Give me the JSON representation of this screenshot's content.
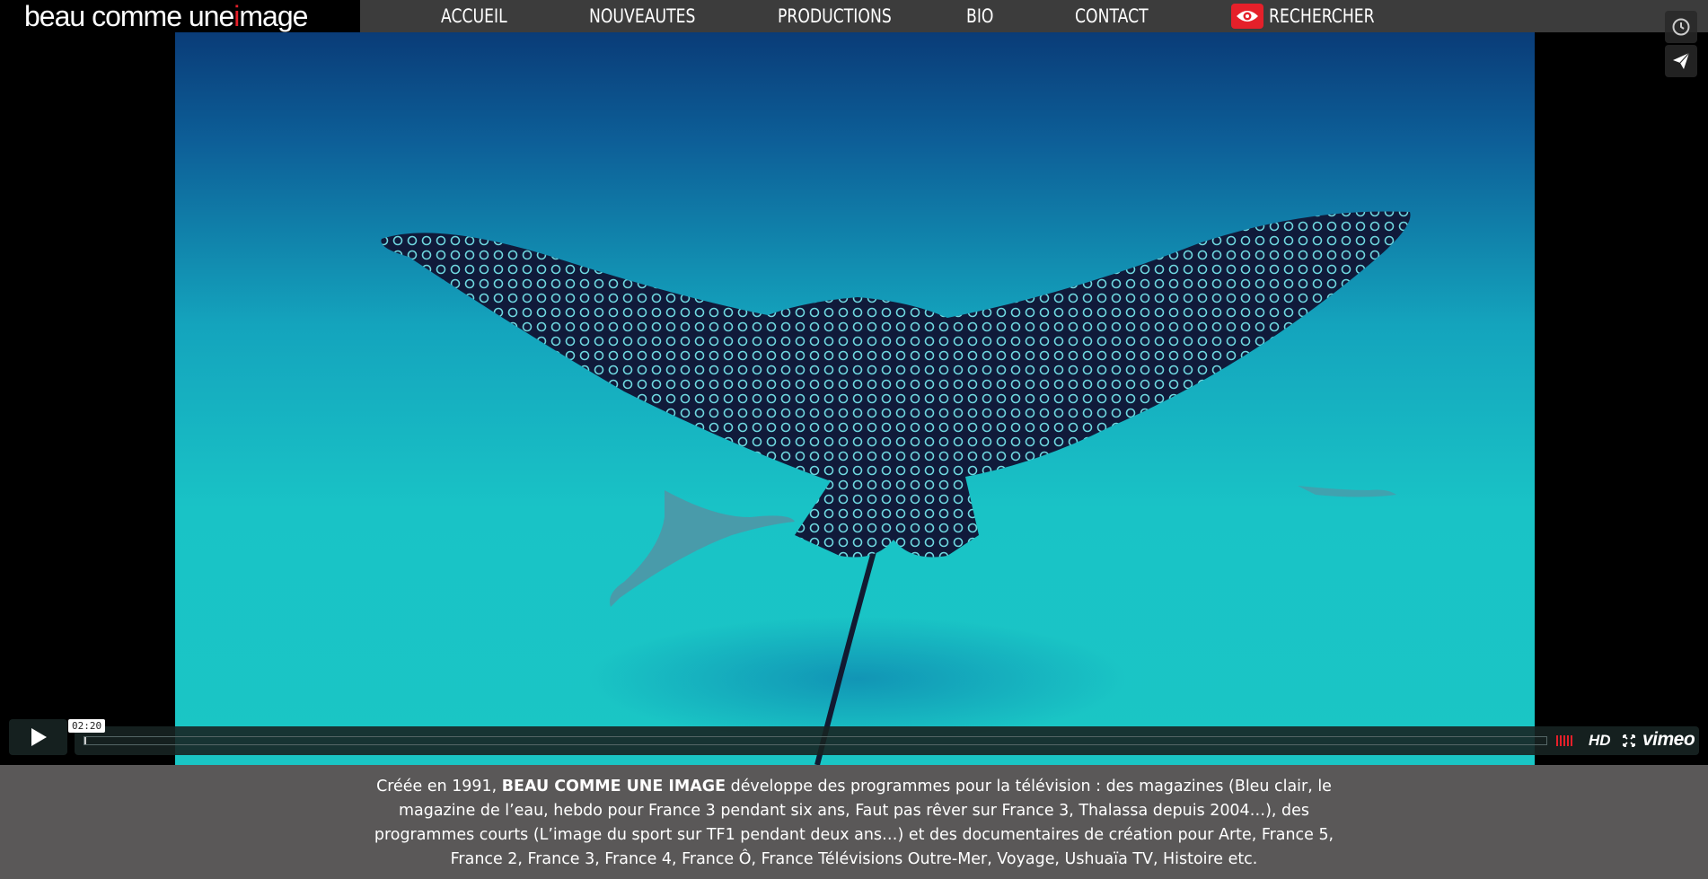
{
  "site": {
    "logo_prefix": "beau comme une ",
    "logo_accent": "i",
    "logo_suffix": "mage",
    "accent_color": "#e5202a"
  },
  "nav": {
    "items": [
      "accueil",
      "nouveautes",
      "productions",
      "bio",
      "contact"
    ],
    "search_label": "rechercher",
    "search_icon": "eye-icon"
  },
  "player": {
    "time_tooltip": "02:20",
    "progress": 0.001,
    "hd_label": "HD",
    "brand": "vimeo",
    "side_icons": [
      "clock-icon",
      "send-icon"
    ]
  },
  "description": {
    "lead": "Créée en 1991, ",
    "company": "BEAU COMME UNE IMAGE",
    "body": " développe des programmes pour la télévision : des magazines (Bleu clair, le magazine de l’eau, hebdo pour France 3 pendant six ans, Faut pas rêver sur France 3, Thalassa depuis 2004…), des programmes courts (L’image du sport sur TF1 pendant deux ans…) et des documentaires de création pour Arte, France 5, France 2, France 3, France 4, France Ô, France Télévisions Outre-Mer, Voyage, Ushuaïa TV, Histoire etc."
  }
}
